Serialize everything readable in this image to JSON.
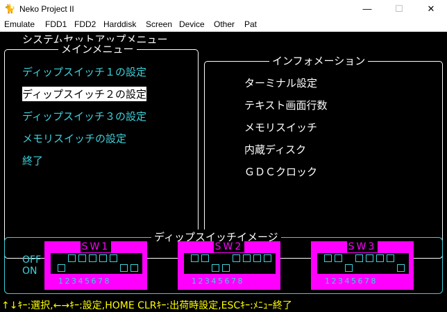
{
  "window": {
    "title": "Neko Project II",
    "controls": {
      "minimize": "—",
      "maximize": "☐",
      "close": "✕"
    }
  },
  "menu": [
    "Emulate",
    "FDD1",
    "FDD2",
    "Harddisk",
    "Screen",
    "Device",
    "Other",
    "Pat"
  ],
  "setup_title": "システムセットアップメニュー",
  "main_menu": {
    "label": "メインメニュー",
    "items": [
      "ディップスイッチ１の設定",
      "ディップスイッチ２の設定",
      "ディップスイッチ３の設定",
      "メモリスイッチの設定",
      "終了"
    ],
    "selected_index": 1
  },
  "info": {
    "label": "インフォメーション",
    "items": [
      "ターミナル設定",
      "テキスト画面行数",
      "メモリスイッチ",
      "内蔵ディスク",
      "ＧＤＣクロック"
    ]
  },
  "dip_image": {
    "label": "ディップスイッチイメージ",
    "off_label": "OFF",
    "on_label": "ON",
    "numbers": "12345678",
    "switches": [
      {
        "name": "SW1",
        "states": [
          "on",
          "off",
          "off",
          "off",
          "off",
          "off",
          "on",
          "on"
        ]
      },
      {
        "name": "SW2",
        "states": [
          "off",
          "off",
          "on",
          "on",
          "off",
          "off",
          "off",
          "off"
        ]
      },
      {
        "name": "SW3",
        "states": [
          "off",
          "off",
          "on",
          "off",
          "off",
          "off",
          "off",
          "on"
        ]
      }
    ]
  },
  "help_text": "↑↓ｷｰ:選択,←→ｷｰ:設定,HOME CLRｷｰ:出荷時設定,ESCｷｰ:ﾒﾆｭｰ終了"
}
